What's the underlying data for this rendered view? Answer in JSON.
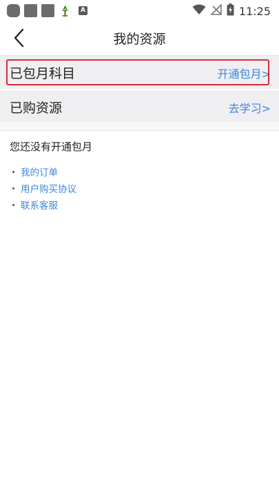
{
  "status_bar": {
    "time": "11:25",
    "a_icon_letter": "A"
  },
  "header": {
    "title": "我的资源"
  },
  "rows": [
    {
      "label": "已包月科目",
      "action": "开通包月>"
    },
    {
      "label": "已购资源",
      "action": "去学习>"
    }
  ],
  "notice": "您还没有开通包月",
  "links": [
    {
      "label": "我的订单"
    },
    {
      "label": "用户购买协议"
    },
    {
      "label": "联系客服"
    }
  ],
  "colors": {
    "link": "#3c86e0",
    "highlight_border": "#e2263a",
    "row_background": "#efeff1"
  }
}
